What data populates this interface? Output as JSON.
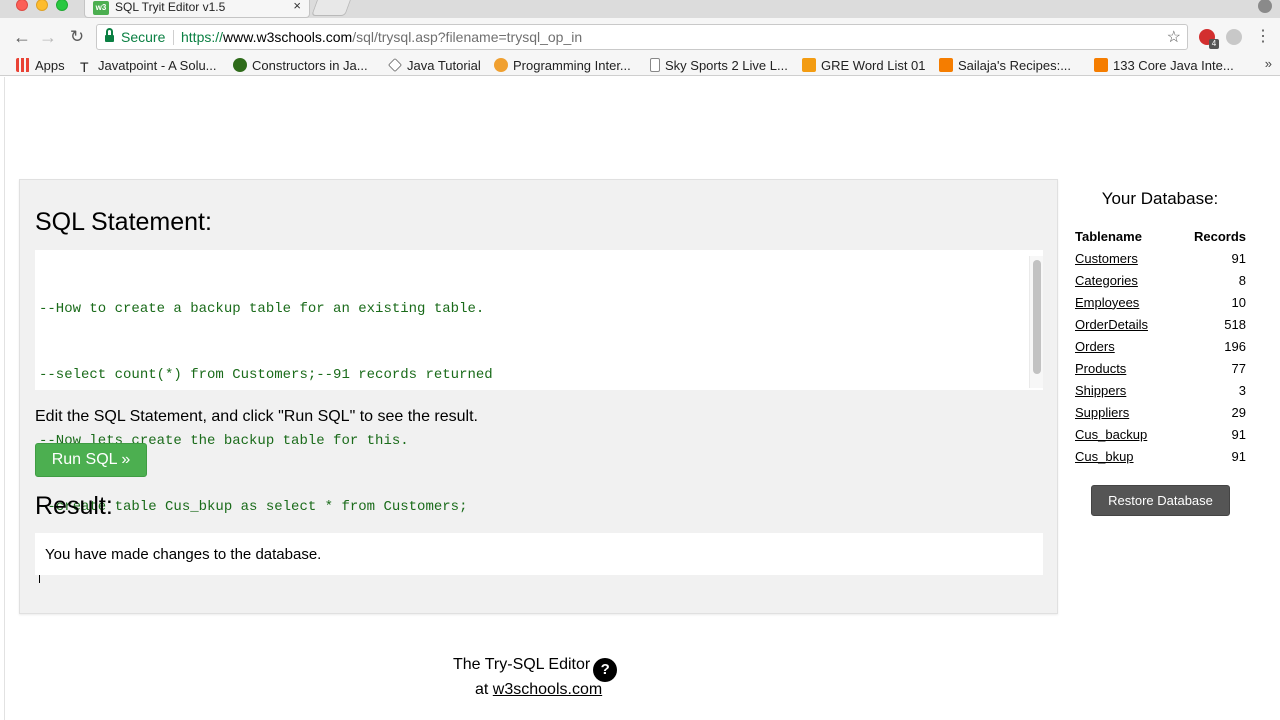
{
  "browser": {
    "tab_title": "SQL Tryit Editor v1.5",
    "tab_favicon": "w3",
    "tab_close": "×",
    "secure_label": "Secure",
    "url_scheme": "https://",
    "url_host": "www.w3schools.com",
    "url_path": "/sql/trysql.asp?filename=trysql_op_in",
    "extension_badge": "4",
    "bookmarks": [
      {
        "label": "Apps",
        "icon": "apps-grid-icon"
      },
      {
        "label": "Javatpoint - A Solu...",
        "icon": "javatpoint-icon"
      },
      {
        "label": "Constructors in Ja...",
        "icon": "constructors-icon"
      },
      {
        "label": "Java Tutorial",
        "icon": "java-tutorial-icon"
      },
      {
        "label": "Programming Inter...",
        "icon": "programming-icon"
      },
      {
        "label": "Sky Sports 2 Live L...",
        "icon": "page-icon"
      },
      {
        "label": "GRE Word List 01",
        "icon": "gre-icon"
      },
      {
        "label": "Sailaja's Recipes:...",
        "icon": "blogger-icon"
      },
      {
        "label": "133 Core Java Inte...",
        "icon": "blogger-icon"
      }
    ],
    "bookmarks_more": "»"
  },
  "editor": {
    "heading": "SQL Statement:",
    "code": [
      "--How to create a backup table for an existing table.",
      "--select count(*) from Customers;--91 records returned",
      "--Now lets create the backup table for this.",
      "--create table Cus_bkup as select * from Customers;"
    ],
    "instructions": "Edit the SQL Statement, and click \"Run SQL\" to see the result.",
    "run_button": "Run SQL »",
    "result_heading": "Result:",
    "result_text": "You have made changes to the database."
  },
  "database": {
    "title": "Your Database:",
    "col_tablename": "Tablename",
    "col_records": "Records",
    "tables": [
      {
        "name": "Customers",
        "records": "91"
      },
      {
        "name": "Categories",
        "records": "8"
      },
      {
        "name": "Employees",
        "records": "10"
      },
      {
        "name": "OrderDetails",
        "records": "518"
      },
      {
        "name": "Orders",
        "records": "196"
      },
      {
        "name": "Products",
        "records": "77"
      },
      {
        "name": "Shippers",
        "records": "3"
      },
      {
        "name": "Suppliers",
        "records": "29"
      },
      {
        "name": "Cus_backup",
        "records": "91"
      },
      {
        "name": "Cus_bkup",
        "records": "91"
      }
    ],
    "restore_button": "Restore Database"
  },
  "footer": {
    "line1": "The Try-SQL Editor",
    "help_glyph": "?",
    "line2_prefix": "at",
    "link": "w3schools.com"
  },
  "colors": {
    "run_button": "#4caf50",
    "code_text": "#1a6b1a",
    "secure_green": "#0b8043",
    "restore_button": "#555555"
  }
}
